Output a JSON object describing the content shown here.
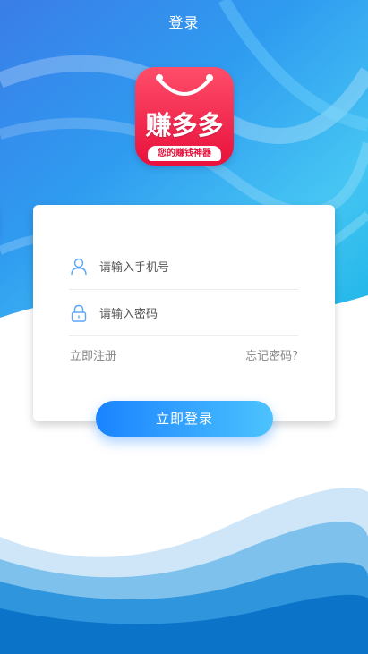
{
  "header": {
    "title": "登录"
  },
  "logo": {
    "main_text": "赚多多",
    "slogan": "您的赚钱神器"
  },
  "form": {
    "phone_placeholder": "请输入手机号",
    "password_placeholder": "请输入密码",
    "register_label": "立即注册",
    "forgot_label": "忘记密码?",
    "login_label": "立即登录"
  },
  "colors": {
    "brand_red": "#e8113c",
    "button_start": "#1a83ff",
    "button_end": "#4cc3fd",
    "icon_blue": "#5aa5f5"
  }
}
